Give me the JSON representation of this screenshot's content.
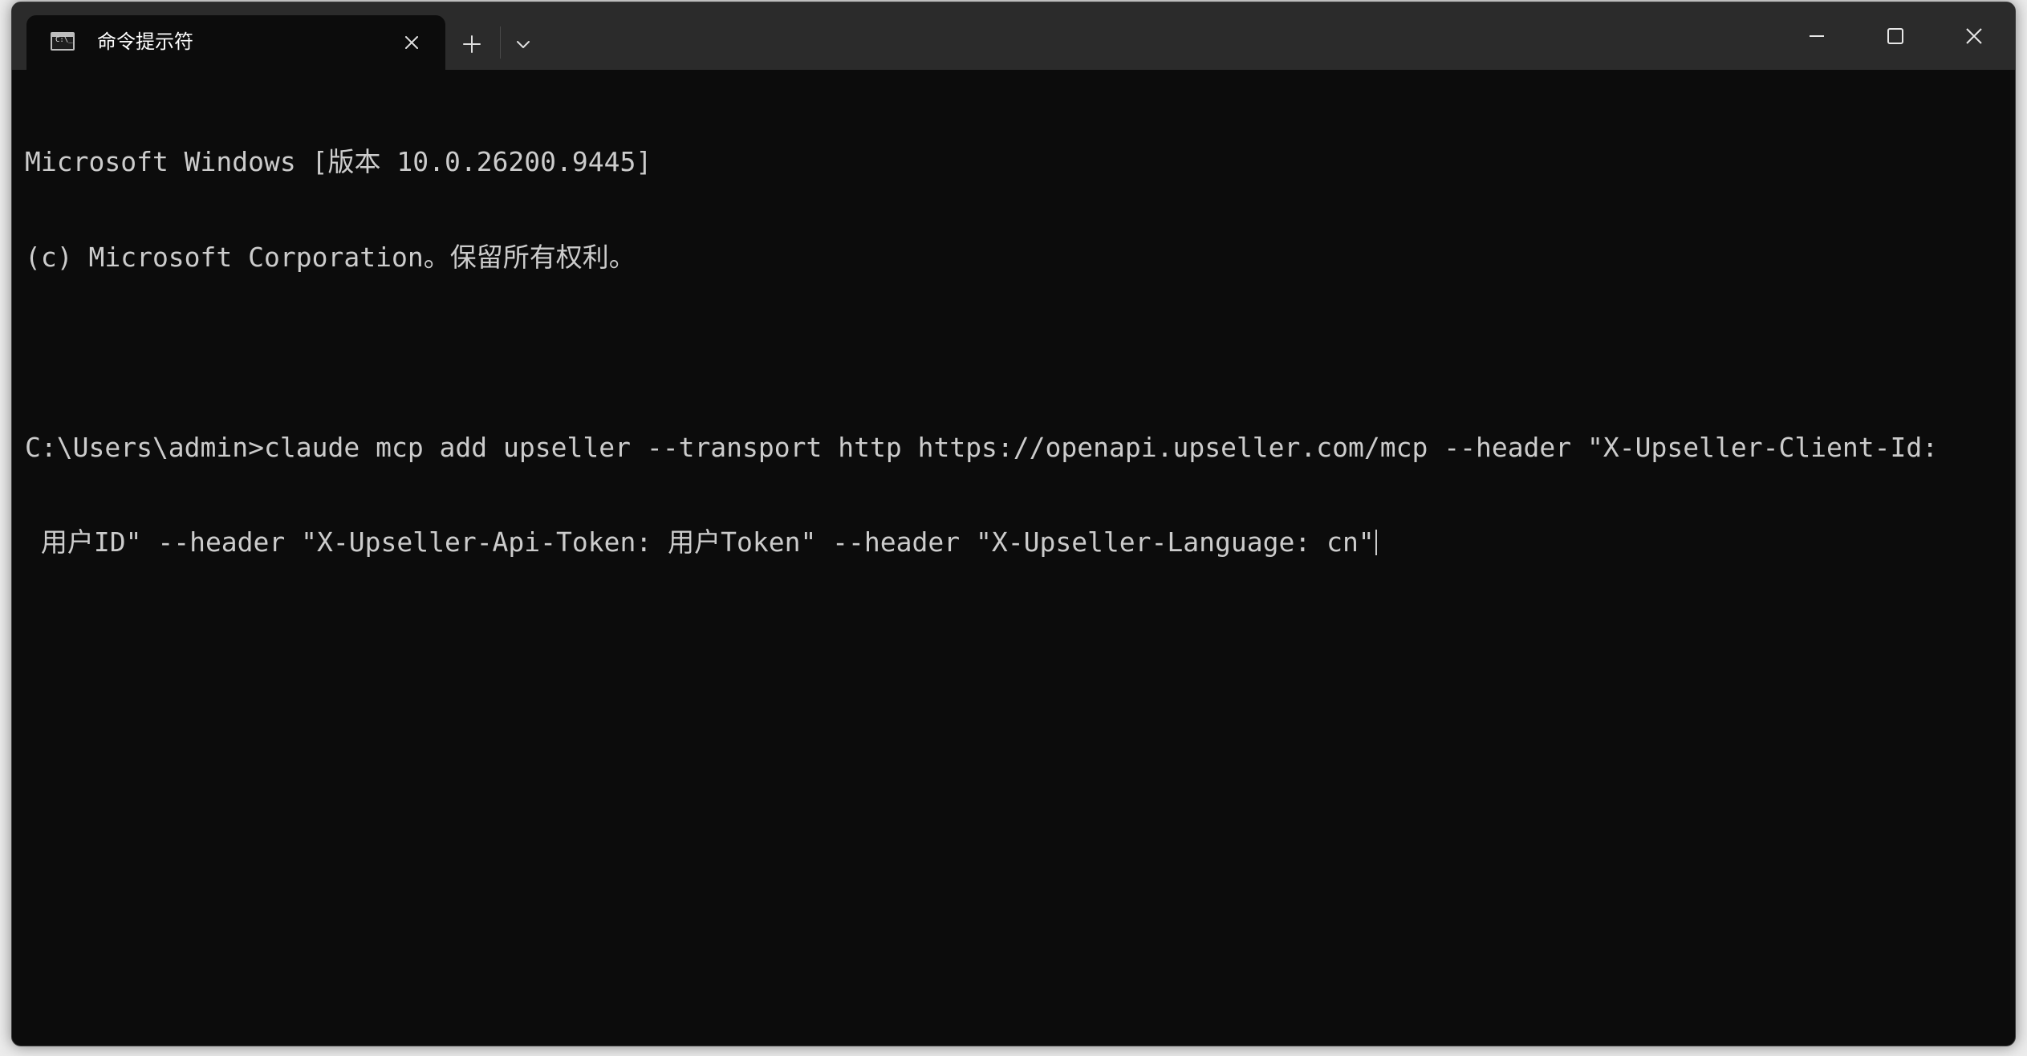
{
  "window": {
    "tab_title": "命令提示符",
    "tab_icon": "cmd-prompt-icon",
    "tab_icon_glyph": "C:\\_",
    "controls": {
      "close_tab_icon": "close-icon",
      "new_tab_icon": "plus-icon",
      "dropdown_icon": "chevron-down-icon",
      "minimize_icon": "minimize-icon",
      "maximize_icon": "maximize-icon",
      "close_window_icon": "close-icon"
    }
  },
  "terminal": {
    "banner_line1": "Microsoft Windows [版本 10.0.26200.9445]",
    "banner_line2": "(c) Microsoft Corporation。保留所有权利。",
    "prompt": "C:\\Users\\admin>",
    "command_line1": "claude mcp add upseller --transport http https://openapi.upseller.com/mcp --header \"X-Upseller-Client-Id:",
    "command_line2": " 用户ID\" --header \"X-Upseller-Api-Token: 用户Token\" --header \"X-Upseller-Language: cn\""
  },
  "colors": {
    "terminal_bg": "#0c0c0c",
    "titlebar_bg": "#2b2b2b",
    "text": "#cccccc"
  }
}
